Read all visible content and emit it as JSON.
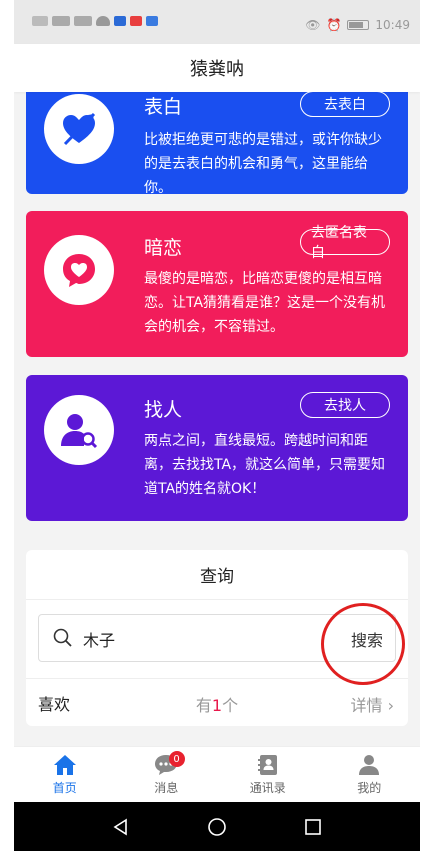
{
  "status_bar": {
    "time": "10:49"
  },
  "app": {
    "title": "猿粪呐"
  },
  "cards": [
    {
      "title": "表白",
      "button": "去表白",
      "desc": "比被拒绝更可悲的是错过，或许你缺少的是去表白的机会和勇气，这里能给你。",
      "color": "#1a4ff0",
      "icon": "heart-arrow-icon"
    },
    {
      "title": "暗恋",
      "button": "去匿名表白",
      "desc": "最傻的是暗恋，比暗恋更傻的是相互暗恋。让TA猜猜看是谁？这是一个没有机会的机会，不容错过。",
      "color": "#f21d5b",
      "icon": "heart-bubble-icon"
    },
    {
      "title": "找人",
      "button": "去找人",
      "desc": "两点之间，直线最短。跨越时间和距离，去找找TA，就这么简单，只需要知道TA的姓名就OK！",
      "color": "#5c18d6",
      "icon": "person-search-icon"
    }
  ],
  "query": {
    "title": "查询",
    "search_value": "木子",
    "search_button": "搜索",
    "like_label": "喜欢",
    "like_prefix": "有",
    "like_count": "1",
    "like_suffix": "个",
    "detail_label": "详情",
    "detail_chevron": "›"
  },
  "tabs": [
    {
      "label": "首页",
      "icon": "home-icon",
      "active": true
    },
    {
      "label": "消息",
      "icon": "chat-icon",
      "badge": "0"
    },
    {
      "label": "通讯录",
      "icon": "contacts-icon"
    },
    {
      "label": "我的",
      "icon": "profile-icon"
    }
  ]
}
